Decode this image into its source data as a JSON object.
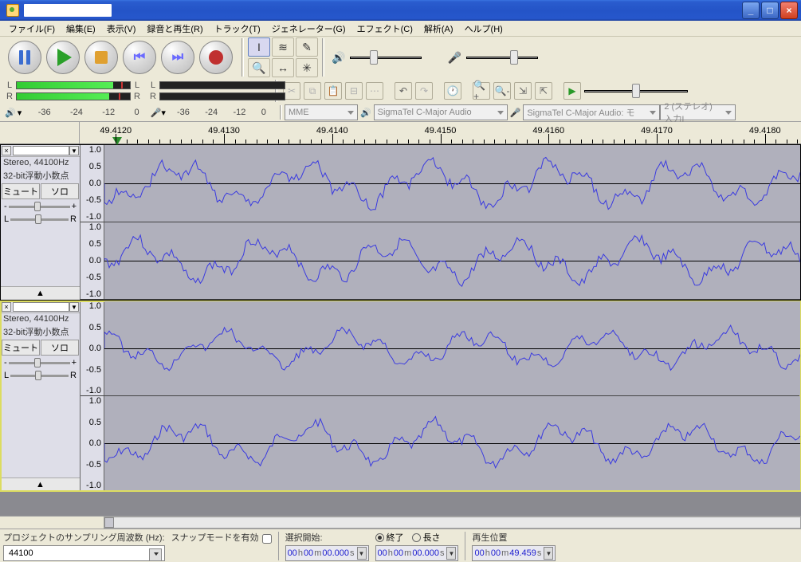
{
  "menus": {
    "file": "ファイル(F)",
    "edit": "編集(E)",
    "view": "表示(V)",
    "record": "録音と再生(R)",
    "tracks": "トラック(T)",
    "generate": "ジェネレーター(G)",
    "effect": "エフェクト(C)",
    "analyze": "解析(A)",
    "help": "ヘルプ(H)"
  },
  "meter": {
    "L": "L",
    "R": "R",
    "ticks": [
      "-36",
      "-24",
      "-12",
      "0"
    ]
  },
  "devices": {
    "host": "MME",
    "out": "SigmaTel C-Major Audio",
    "in": "SigmaTel C-Major Audio: モ",
    "ch": "2 (ステレオ)入力I"
  },
  "ruler": {
    "labels": [
      "49.4120",
      "49.4130",
      "49.4140",
      "49.4150",
      "49.4160",
      "49.4170",
      "49.4180"
    ],
    "playpos": 5
  },
  "track": {
    "info1": "Stereo, 44100Hz",
    "info2": "32-bit浮動小数点",
    "mute": "ミュート",
    "solo": "ソロ",
    "L": "L",
    "R": "R",
    "scale": [
      "1.0",
      "0.5",
      "0.0",
      "-0.5",
      "-1.0"
    ],
    "minus": "-",
    "plus": "+",
    "collapse_up": "▲"
  },
  "status": {
    "rateLabel": "プロジェクトのサンプリング周波数 (Hz):",
    "rate": "44100",
    "snap": "スナップモードを有効",
    "selStart": "選択開始:",
    "end": "終了",
    "len": "長さ",
    "playpos": "再生位置",
    "zero": {
      "h": "00",
      "m": "00",
      "s": "00.000"
    },
    "pos": {
      "h": "00",
      "m": "00",
      "s": "49.459"
    },
    "uh": "h",
    "um": "m",
    "us": "s"
  }
}
